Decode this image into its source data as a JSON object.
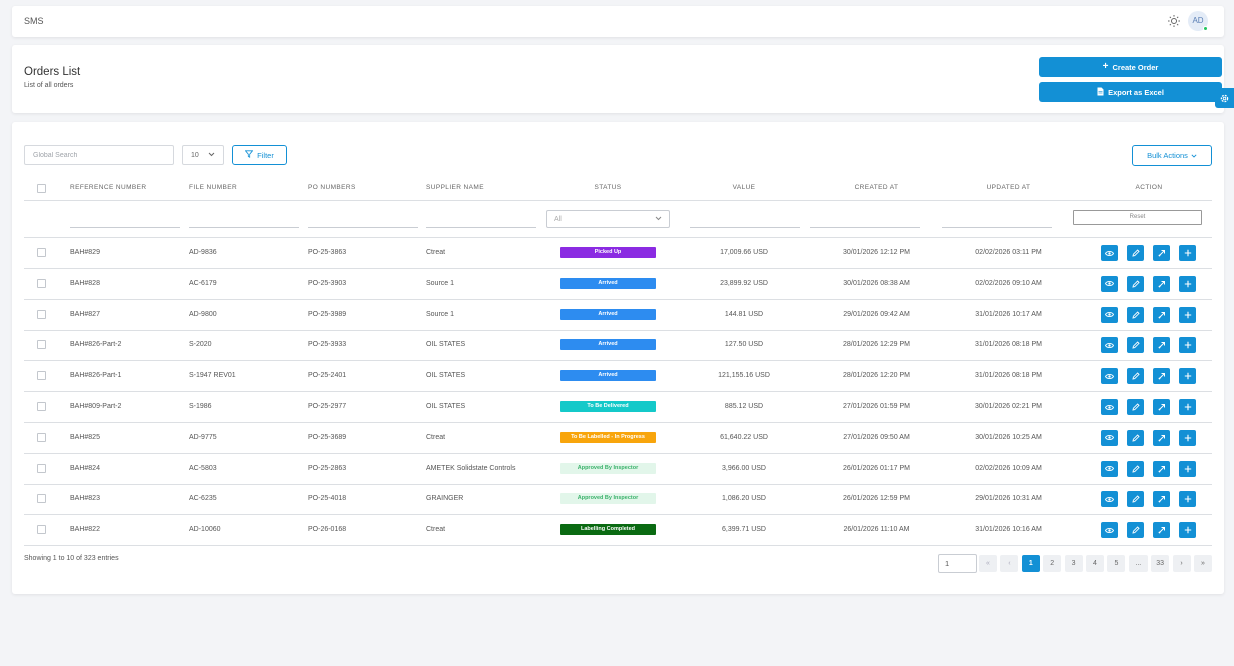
{
  "topbar": {
    "app_name": "SMS",
    "avatar_initials": "AD"
  },
  "header": {
    "title": "Orders List",
    "subtitle": "List of all orders",
    "create_label": "Create Order",
    "export_label": "Export as Excel"
  },
  "toolbar": {
    "search_placeholder": "Global Search",
    "page_size": "10",
    "filter_label": "Filter",
    "bulk_label": "Bulk Actions"
  },
  "columns": {
    "reference": "REFERENCE NUMBER",
    "file": "FILE NUMBER",
    "po": "PO NUMBERS",
    "supplier": "SUPPLIER NAME",
    "status": "STATUS",
    "value": "VALUE",
    "created": "CREATED AT",
    "updated": "UPDATED AT",
    "action": "ACTION"
  },
  "filters": {
    "status_selected": "All",
    "reset_label": "Reset"
  },
  "rows": [
    {
      "ref": "BAH#829",
      "file": "AD-9836",
      "po": "PO-25-3863",
      "supplier": "Ctreat",
      "status": "Picked Up",
      "value": "17,009.66 USD",
      "created": "30/01/2026 12:12 PM",
      "updated": "02/02/2026 03:11 PM"
    },
    {
      "ref": "BAH#828",
      "file": "AC-6179",
      "po": "PO-25-3903",
      "supplier": "Source 1",
      "status": "Arrived",
      "value": "23,899.92 USD",
      "created": "30/01/2026 08:38 AM",
      "updated": "02/02/2026 09:10 AM"
    },
    {
      "ref": "BAH#827",
      "file": "AD-9800",
      "po": "PO-25-3989",
      "supplier": "Source 1",
      "status": "Arrived",
      "value": "144.81 USD",
      "created": "29/01/2026 09:42 AM",
      "updated": "31/01/2026 10:17 AM"
    },
    {
      "ref": "BAH#826-Part-2",
      "file": "S-2020",
      "po": "PO-25-3933",
      "supplier": "OIL STATES",
      "status": "Arrived",
      "value": "127.50 USD",
      "created": "28/01/2026 12:29 PM",
      "updated": "31/01/2026 08:18 PM"
    },
    {
      "ref": "BAH#826-Part-1",
      "file": "S-1947 REV01",
      "po": "PO-25-2401",
      "supplier": "OIL STATES",
      "status": "Arrived",
      "value": "121,155.16 USD",
      "created": "28/01/2026 12:20 PM",
      "updated": "31/01/2026 08:18 PM"
    },
    {
      "ref": "BAH#809-Part-2",
      "file": "S-1986",
      "po": "PO-25-2977",
      "supplier": "OIL STATES",
      "status": "To Be Delivered",
      "value": "885.12 USD",
      "created": "27/01/2026 01:59 PM",
      "updated": "30/01/2026 02:21 PM"
    },
    {
      "ref": "BAH#825",
      "file": "AD-9775",
      "po": "PO-25-3689",
      "supplier": "Ctreat",
      "status": "To Be Labelled - In Progress",
      "value": "61,640.22 USD",
      "created": "27/01/2026 09:50 AM",
      "updated": "30/01/2026 10:25 AM"
    },
    {
      "ref": "BAH#824",
      "file": "AC-5803",
      "po": "PO-25-2863",
      "supplier": "AMETEK Solidstate Controls",
      "status": "Approved By Inspector",
      "value": "3,966.00 USD",
      "created": "26/01/2026 01:17 PM",
      "updated": "02/02/2026 10:09 AM"
    },
    {
      "ref": "BAH#823",
      "file": "AC-6235",
      "po": "PO-25-4018",
      "supplier": "GRAINGER",
      "status": "Approved By Inspector",
      "value": "1,086.20 USD",
      "created": "26/01/2026 12:59 PM",
      "updated": "29/01/2026 10:31 AM"
    },
    {
      "ref": "BAH#822",
      "file": "AD-10060",
      "po": "PO-26-0168",
      "supplier": "Ctreat",
      "status": "Labelling Completed",
      "value": "6,399.71 USD",
      "created": "26/01/2026 11:10 AM",
      "updated": "31/01/2026 10:16 AM"
    }
  ],
  "status_colors": {
    "Picked Up": {
      "bg": "#8b2be2",
      "fg": "#ffffff"
    },
    "Arrived": {
      "bg": "#2d8cf0",
      "fg": "#ffffff"
    },
    "To Be Delivered": {
      "bg": "#14c9c9",
      "fg": "#ffffff"
    },
    "To Be Labelled - In Progress": {
      "bg": "#f8a50c",
      "fg": "#ffffff"
    },
    "Approved By Inspector": {
      "bg": "#e2f6ea",
      "fg": "#3bb26b"
    },
    "Labelling Completed": {
      "bg": "#0a6a12",
      "fg": "#ffffff"
    }
  },
  "pagination": {
    "info": "Showing 1 to 10 of 323 entries",
    "jump_value": "1",
    "first": "«",
    "prev": "‹",
    "next": "›",
    "last": "»",
    "pages": [
      "1",
      "2",
      "3",
      "4",
      "5",
      "...",
      "33"
    ],
    "active_page": "1"
  },
  "accent_color": "#1390d5"
}
